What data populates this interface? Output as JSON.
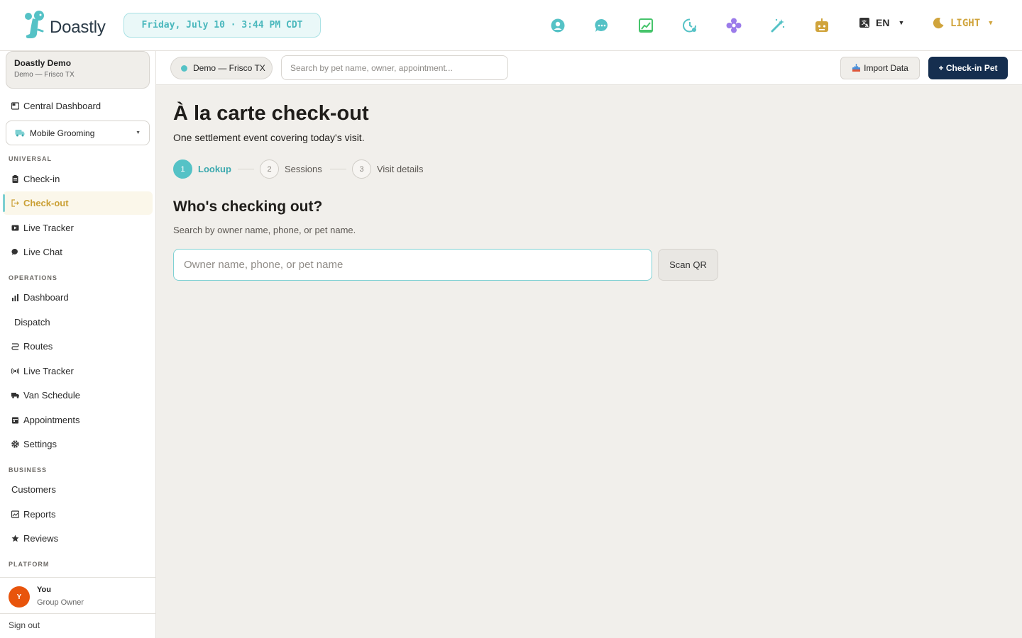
{
  "app": {
    "logo_text": "Doastly",
    "datetime": "Friday, July 10 · 3:44 PM CDT",
    "language": "EN",
    "theme": "LIGHT",
    "colors": {
      "accent": "#55c2c6",
      "gold": "#d0a43c",
      "navy": "#152e4f",
      "avatar": "#e8540c"
    },
    "header_icons": [
      "support-icon",
      "chat-icon",
      "analytics-icon",
      "history-icon",
      "flower-icon",
      "magic-wand-icon",
      "robot-icon",
      "translate-icon",
      "moon-icon"
    ]
  },
  "sidebar": {
    "org_name": "Doastly Demo",
    "org_sub": "Demo — Frisco TX",
    "central_dashboard": "Central Dashboard",
    "module": "Mobile Grooming",
    "sections": {
      "universal": "UNIVERSAL",
      "operations": "OPERATIONS",
      "business": "BUSINESS",
      "platform": "PLATFORM"
    },
    "universal_items": [
      "Check-in",
      "Check-out",
      "Live Tracker",
      "Live Chat"
    ],
    "operations_items": [
      "Dashboard",
      "Dispatch",
      "Routes",
      "Live Tracker",
      "Van Schedule",
      "Appointments",
      "Settings"
    ],
    "business_items": [
      "Customers",
      "Reports",
      "Reviews"
    ],
    "user": {
      "initial": "Y",
      "name": "You",
      "role": "Group Owner"
    },
    "signout": "Sign out"
  },
  "subbar": {
    "location": "Demo — Frisco TX",
    "search_placeholder": "Search by pet name, owner, appointment...",
    "import_label": "Import Data",
    "checkin_label": "+ Check-in Pet"
  },
  "main": {
    "title": "À la carte check-out",
    "subtitle": "One settlement event covering today's visit.",
    "steps": [
      {
        "num": "1",
        "label": "Lookup"
      },
      {
        "num": "2",
        "label": "Sessions"
      },
      {
        "num": "3",
        "label": "Visit details"
      }
    ],
    "question": "Who's checking out?",
    "question_sub": "Search by owner name, phone, or pet name.",
    "lookup_placeholder": "Owner name, phone, or pet name",
    "scan_label": "Scan QR"
  }
}
